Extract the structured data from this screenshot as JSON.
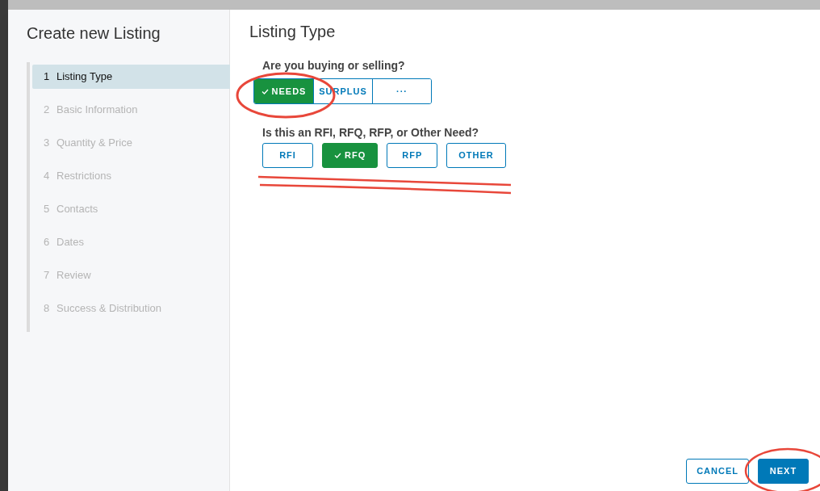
{
  "sidebar": {
    "title": "Create new Listing",
    "steps": [
      {
        "number": "1",
        "label": "Listing Type",
        "selected": true
      },
      {
        "number": "2",
        "label": "Basic Information",
        "selected": false
      },
      {
        "number": "3",
        "label": "Quantity & Price",
        "selected": false
      },
      {
        "number": "4",
        "label": "Restrictions",
        "selected": false
      },
      {
        "number": "5",
        "label": "Contacts",
        "selected": false
      },
      {
        "number": "6",
        "label": "Dates",
        "selected": false
      },
      {
        "number": "7",
        "label": "Review",
        "selected": false
      },
      {
        "number": "8",
        "label": "Success & Distribution",
        "selected": false
      }
    ]
  },
  "page_title": "Listing Type",
  "questions": [
    {
      "label": "Are you buying or selling?",
      "kind": "segmented",
      "options": [
        {
          "label": "NEEDS",
          "selected": true
        },
        {
          "label": "SURPLUS",
          "selected": false
        },
        {
          "label": "···",
          "selected": false
        }
      ]
    },
    {
      "label": "Is this an RFI, RFQ, RFP, or Other Need?",
      "kind": "separate",
      "options": [
        {
          "label": "RFI",
          "selected": false
        },
        {
          "label": "RFQ",
          "selected": true
        },
        {
          "label": "RFP",
          "selected": false
        },
        {
          "label": "OTHER",
          "selected": false
        }
      ]
    }
  ],
  "footer_buttons": [
    {
      "label": "CANCEL",
      "kind": "outline"
    },
    {
      "label": "NEXT",
      "kind": "primary"
    }
  ]
}
